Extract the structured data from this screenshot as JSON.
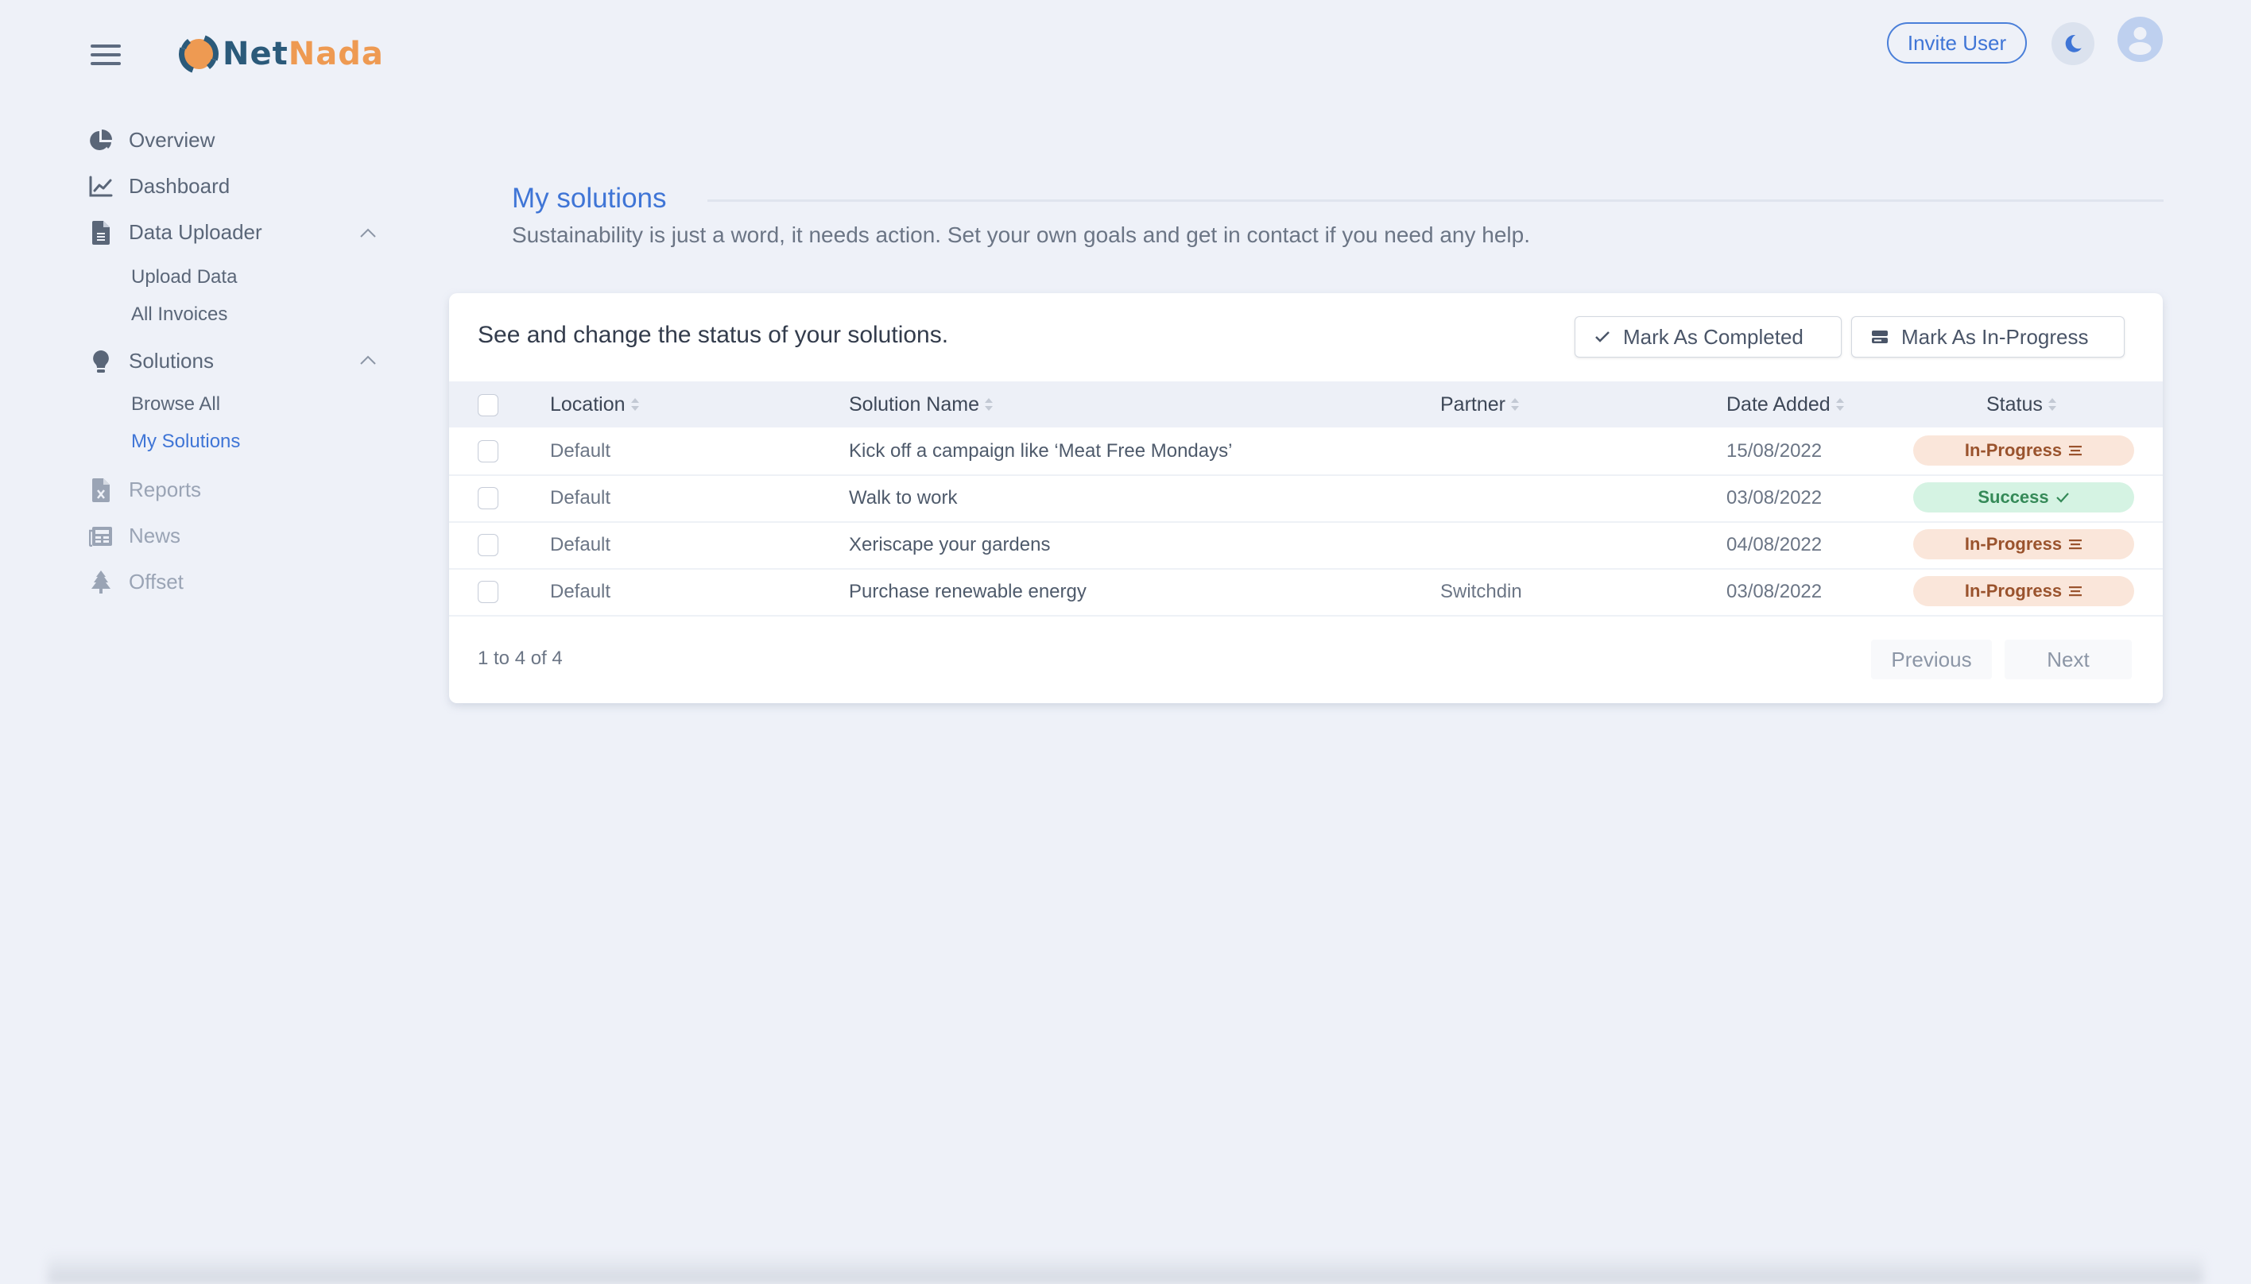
{
  "brand": {
    "name_part1": "Net",
    "name_part2": "Nada",
    "colors": {
      "net": "#2b5a7a",
      "nada": "#ee9a52",
      "accent": "#3f75d6"
    }
  },
  "header": {
    "invite_label": "Invite User",
    "theme_icon": "moon-icon",
    "avatar_icon": "user-icon"
  },
  "sidebar": {
    "items": [
      {
        "label": "Overview",
        "icon": "pie-chart-icon"
      },
      {
        "label": "Dashboard",
        "icon": "line-chart-icon"
      },
      {
        "label": "Data Uploader",
        "icon": "document-icon",
        "expanded": true,
        "children": [
          {
            "label": "Upload Data"
          },
          {
            "label": "All Invoices"
          }
        ]
      },
      {
        "label": "Solutions",
        "icon": "lightbulb-icon",
        "expanded": true,
        "children": [
          {
            "label": "Browse All"
          },
          {
            "label": "My Solutions",
            "active": true
          }
        ]
      },
      {
        "label": "Reports",
        "icon": "excel-file-icon",
        "disabled": true
      },
      {
        "label": "News",
        "icon": "newspaper-icon",
        "disabled": true
      },
      {
        "label": "Offset",
        "icon": "tree-icon",
        "disabled": true
      }
    ]
  },
  "main": {
    "title": "My solutions",
    "subtitle": "Sustainability is just a word, it needs action. Set your own goals and get in contact if you need any help.",
    "card": {
      "title": "See and change the status of your solutions.",
      "mark_completed_label": "Mark As Completed",
      "mark_inprogress_label": "Mark As In-Progress",
      "columns": [
        "Location",
        "Solution Name",
        "Partner",
        "Date Added",
        "Status"
      ],
      "rows": [
        {
          "location": "Default",
          "name": "Kick off a campaign like ‘Meat Free Mondays’",
          "partner": "",
          "date": "15/08/2022",
          "status": "In-Progress"
        },
        {
          "location": "Default",
          "name": "Walk to work",
          "partner": "",
          "date": "03/08/2022",
          "status": "Success"
        },
        {
          "location": "Default",
          "name": "Xeriscape your gardens",
          "partner": "",
          "date": "04/08/2022",
          "status": "In-Progress"
        },
        {
          "location": "Default",
          "name": "Purchase renewable energy",
          "partner": "Switchdin",
          "date": "03/08/2022",
          "status": "In-Progress"
        }
      ],
      "pagination": {
        "info": "1 to 4 of 4",
        "previous_label": "Previous",
        "next_label": "Next"
      }
    }
  }
}
